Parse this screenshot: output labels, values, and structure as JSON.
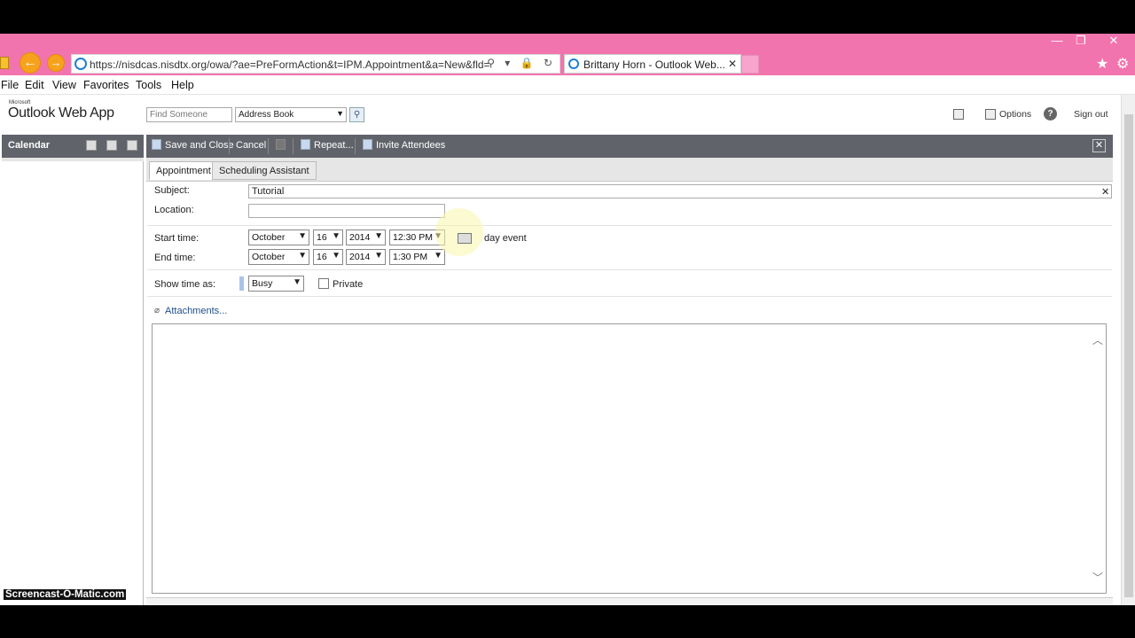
{
  "browser": {
    "url": "https://nisdcas.nisdtx.org/owa/?ae=PreFormAction&t=IPM.Appointment&a=New&fld=",
    "tab_title": "Brittany Horn - Outlook Web...",
    "tab_close": "✕",
    "window_buttons": [
      "—",
      "❐",
      "✕"
    ],
    "back": "←",
    "forward": "→",
    "address_tools": "⚲ ▾ 🔒 ↻"
  },
  "menu": [
    "File",
    "Edit",
    "View",
    "Favorites",
    "Tools",
    "Help"
  ],
  "owa": {
    "logo_small": "Microsoft",
    "logo": "Outlook Web App",
    "find_placeholder": "Find Someone",
    "address_book": "Address Book",
    "options": "Options",
    "sign_out": "Sign out",
    "help": "?"
  },
  "leftnav": {
    "title": "Calendar"
  },
  "toolbar": {
    "save_close": "Save and Close",
    "cancel": "Cancel",
    "repeat": "Repeat...",
    "invite": "Invite Attendees",
    "close": "✕"
  },
  "tabs": {
    "appointment": "Appointment",
    "scheduling": "Scheduling Assistant"
  },
  "form": {
    "subject_label": "Subject:",
    "subject_value": "Tutorial",
    "location_label": "Location:",
    "start_label": "Start time:",
    "end_label": "End time:",
    "show_as_label": "Show time as:",
    "start": {
      "month": "October",
      "day": "16",
      "year": "2014",
      "time": "12:30 PM"
    },
    "end": {
      "month": "October",
      "day": "16",
      "year": "2014",
      "time": "1:30 PM"
    },
    "all_day": "day event",
    "show_as": "Busy",
    "private": "Private",
    "attachments": "Attachments..."
  },
  "watermark": "Screencast-O-Matic.com"
}
